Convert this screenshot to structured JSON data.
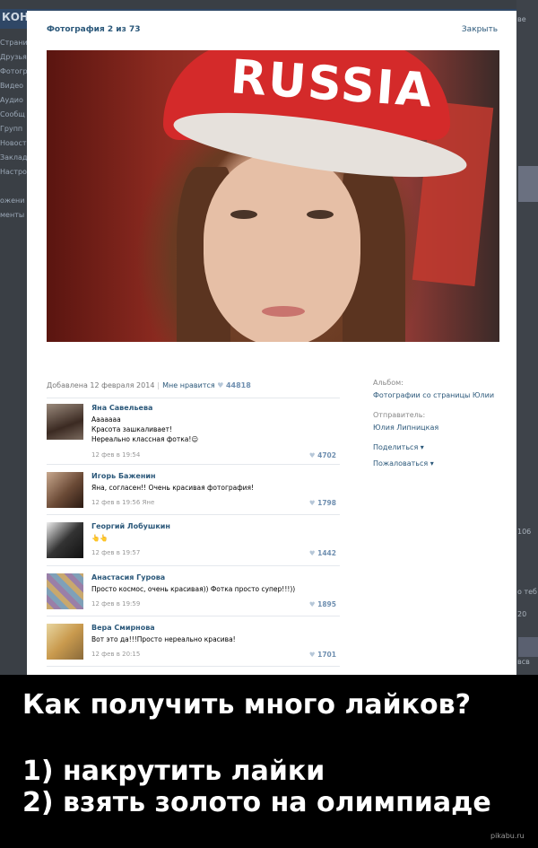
{
  "background_page": {
    "logo": "КОН",
    "sidebar_items": [
      "Страни",
      "Друзья",
      "Фотогр",
      "Видео",
      "Аудио",
      "Сообщ",
      "Групп",
      "Новост",
      "Заклад",
      "Настро",
      "",
      "ожени",
      "менты"
    ],
    "right_texts": [
      "ве",
      "106",
      "о теб",
      "20",
      "всв"
    ]
  },
  "viewer": {
    "title": "Фотография 2 из 73",
    "close_label": "Закрыть"
  },
  "photo": {
    "cap_text": "RUSSIA"
  },
  "meta": {
    "added": "Добавлена 12 февраля 2014",
    "separator": "|",
    "like_label": "Мне нравится",
    "heart": "♥",
    "likes_count": "44818"
  },
  "comments": [
    {
      "name": "Яна Савельева",
      "lines": [
        "Ааааааа",
        "Красота зашкаливает!",
        "Нереально классная фотка!☺"
      ],
      "date": "12 фев в 19:54",
      "likes": "4702",
      "avatar_color": "#6b5b4e"
    },
    {
      "name": "Игорь Баженин",
      "lines": [
        "Яна, согласен!! Очень красивая фотография!"
      ],
      "date": "12 фев в 19:56 Яне",
      "likes": "1798",
      "avatar_color": "#8a6a55"
    },
    {
      "name": "Георгий Лобушкин",
      "lines": [
        "👆👆"
      ],
      "date": "12 фев в 19:57",
      "likes": "1442",
      "avatar_color": "#555555"
    },
    {
      "name": "Анастасия Гурова",
      "lines": [
        "Просто космос, очень красивая)) Фотка просто супер!!!))"
      ],
      "date": "12 фев в 19:59",
      "likes": "1895",
      "avatar_color": "#b08a5c"
    },
    {
      "name": "Вера Смирнова",
      "lines": [
        "Вот это да!!!Просто нереально красива!"
      ],
      "date": "12 фев в 20:15",
      "likes": "1701",
      "avatar_color": "#c9a86a"
    }
  ],
  "sidebar": {
    "album_label": "Альбом:",
    "album_value": "Фотографии со страницы Юлии",
    "sender_label": "Отправитель:",
    "sender_value": "Юлия Липницкая",
    "share": "Поделиться ▾",
    "report": "Пожаловаться ▾"
  },
  "caption": {
    "question": "Как получить много лайков?",
    "answer1": "1) накрутить лайки",
    "answer2": "2) взять золото на олимпиаде"
  },
  "watermark": "pikabu.ru",
  "colors": {
    "link": "#2b587a",
    "like_count": "#6f8fb0",
    "caption_bg": "#000000",
    "caption_text": "#ffffff"
  }
}
